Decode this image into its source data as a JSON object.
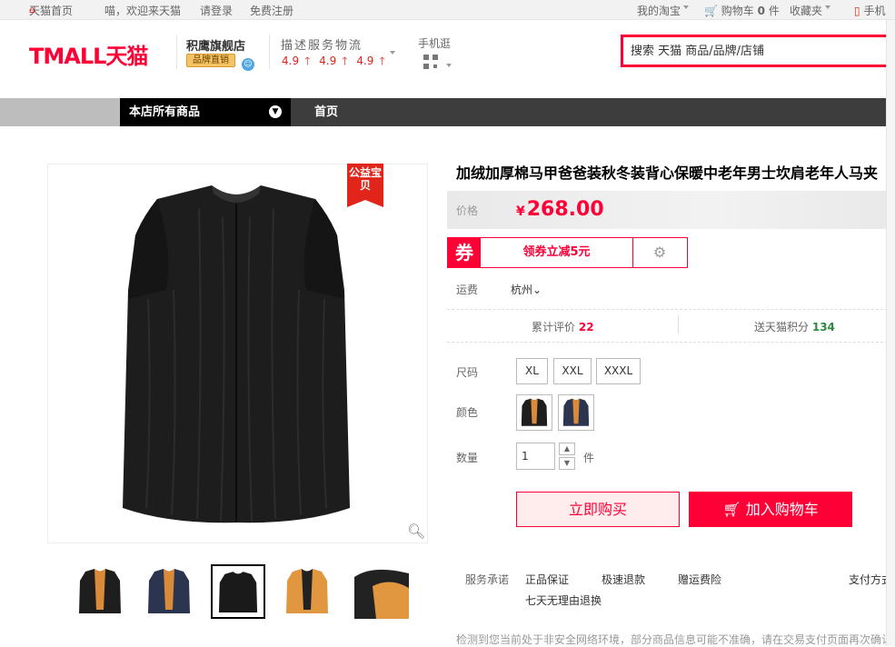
{
  "topbar": {
    "home": "天猫首页",
    "welcome": "喵，欢迎来天猫",
    "login": "请登录",
    "register": "免费注册",
    "my_taobao": "我的淘宝",
    "cart_label": "购物车",
    "cart_count": "0",
    "cart_unit": "件",
    "favorites": "收藏夹",
    "mobile": "手机"
  },
  "header": {
    "logo": "TMALL天猫",
    "shop_name": "积鹰旗舰店",
    "shop_badge": "品牌直销",
    "dsr_title": "描述服务物流",
    "dsr_scores": [
      "4.9",
      "4.9",
      "4.9"
    ],
    "mobile_label": "手机逛",
    "search_placeholder": "搜索 天猫 商品/品牌/店铺"
  },
  "nav": {
    "all_products": "本店所有商品",
    "home": "首页"
  },
  "gallery": {
    "charity_tag": "公益宝贝",
    "thumbnails": [
      "thumb-1",
      "thumb-2",
      "thumb-3",
      "thumb-4",
      "thumb-5"
    ],
    "selected_thumb": 2
  },
  "product": {
    "title": "加绒加厚棉马甲爸爸装秋冬装背心保暖中老年男士坎肩老年人马夹",
    "price_label": "价格",
    "currency": "¥",
    "price": "268.00",
    "coupon_tag": "券",
    "coupon_text": "领券立减5元",
    "shipping_label": "运费",
    "shipping_from": "杭州",
    "reviews_label": "累计评价",
    "reviews_count": "22",
    "points_label": "送天猫积分",
    "points_count": "134",
    "size_label": "尺码",
    "sizes": [
      "XL",
      "XXL",
      "XXXL"
    ],
    "color_label": "颜色",
    "qty_label": "数量",
    "qty_value": "1",
    "qty_unit": "件",
    "buy_now": "立即购买",
    "add_to_cart": "加入购物车"
  },
  "services": {
    "label": "服务承诺",
    "items": [
      "正品保证",
      "极速退款",
      "赠运费险",
      "七天无理由退换"
    ],
    "payment": "支付方式"
  },
  "notice": "检测到您当前处于非安全网络环境，部分商品信息可能不准确，请在交易支付页面再次确认具",
  "colors": {
    "brand_red": "#ff0036",
    "nav_dark": "#3d3d3d"
  }
}
